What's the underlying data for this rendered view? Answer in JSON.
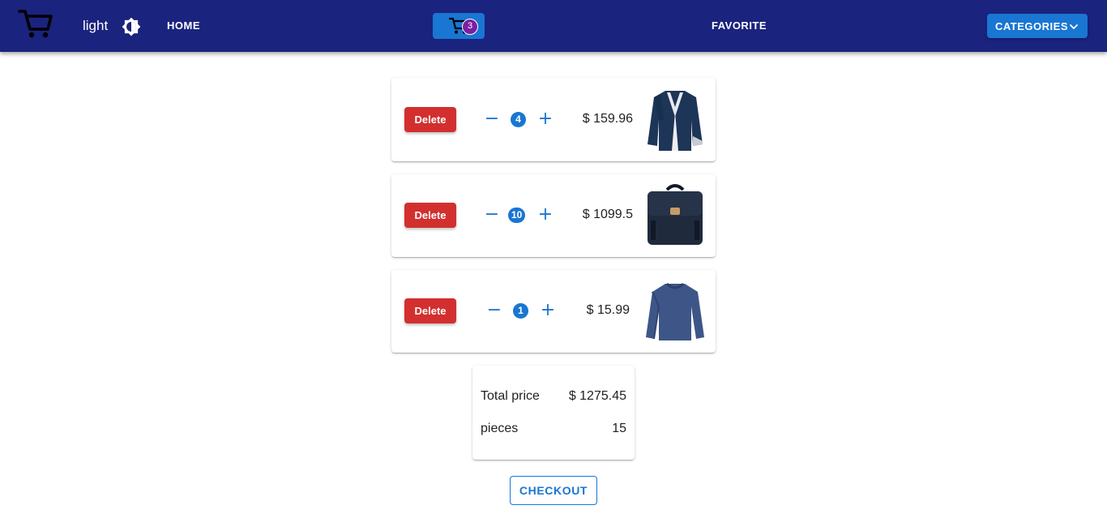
{
  "header": {
    "logo_icon": "shopping-cart-icon",
    "theme_label": "light",
    "theme_icon": "brightness-icon",
    "home_label": "HOME",
    "cart_icon": "shopping-cart-icon",
    "cart_count": "3",
    "favorite_label": "FAVORITE",
    "categories_label": "CATEGORIES",
    "categories_icon": "chevron-down-icon"
  },
  "cart": {
    "items": [
      {
        "delete_label": "Delete",
        "quantity": "4",
        "price": "$ 159.96",
        "image": "navy-blazer-jacket"
      },
      {
        "delete_label": "Delete",
        "quantity": "10",
        "price": "$ 1099.5",
        "image": "navy-backpack"
      },
      {
        "delete_label": "Delete",
        "quantity": "1",
        "price": "$ 15.99",
        "image": "blue-long-sleeve-shirt"
      }
    ],
    "decrement_icon": "minus-icon",
    "increment_icon": "plus-icon"
  },
  "summary": {
    "total_label": "Total price",
    "total_value": "$ 1275.45",
    "pieces_label": "pieces",
    "pieces_value": "15"
  },
  "checkout_label": "CHECKOUT",
  "colors": {
    "appbar": "#1a237e",
    "primary": "#1976d2",
    "danger": "#d32f2f",
    "badge": "#7b1fa2"
  }
}
